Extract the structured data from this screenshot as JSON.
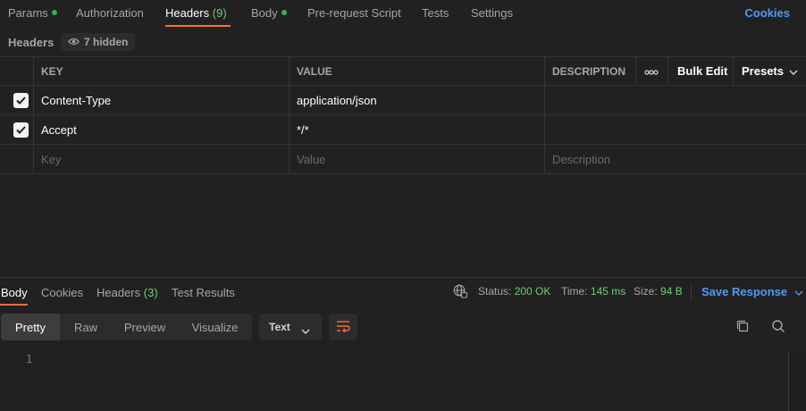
{
  "request_tabs": {
    "params": "Params",
    "authorization": "Authorization",
    "headers": "Headers",
    "headers_count": "(9)",
    "body": "Body",
    "prerequest": "Pre-request Script",
    "tests": "Tests",
    "settings": "Settings",
    "cookies": "Cookies"
  },
  "headers_bar": {
    "title": "Headers",
    "hidden": "7 hidden"
  },
  "table": {
    "columns": {
      "key": "KEY",
      "value": "VALUE",
      "description": "DESCRIPTION"
    },
    "bulk_edit": "Bulk Edit",
    "presets": "Presets",
    "rows": [
      {
        "key": "Content-Type",
        "value": "application/json",
        "description": ""
      },
      {
        "key": "Accept",
        "value": "*/*",
        "description": ""
      }
    ],
    "placeholders": {
      "key": "Key",
      "value": "Value",
      "description": "Description"
    }
  },
  "response": {
    "tabs": {
      "body": "Body",
      "cookies": "Cookies",
      "headers": "Headers",
      "headers_count": "(3)",
      "test_results": "Test Results"
    },
    "status_label": "Status:",
    "status_value": "200 OK",
    "time_label": "Time:",
    "time_value": "145 ms",
    "size_label": "Size:",
    "size_value": "94 B",
    "save": "Save Response",
    "views": [
      "Pretty",
      "Raw",
      "Preview",
      "Visualize"
    ],
    "format": "Text",
    "line_number": "1"
  },
  "colors": {
    "accent": "#ff6c37",
    "link": "#4d9bf5",
    "success": "#6bcf73"
  }
}
